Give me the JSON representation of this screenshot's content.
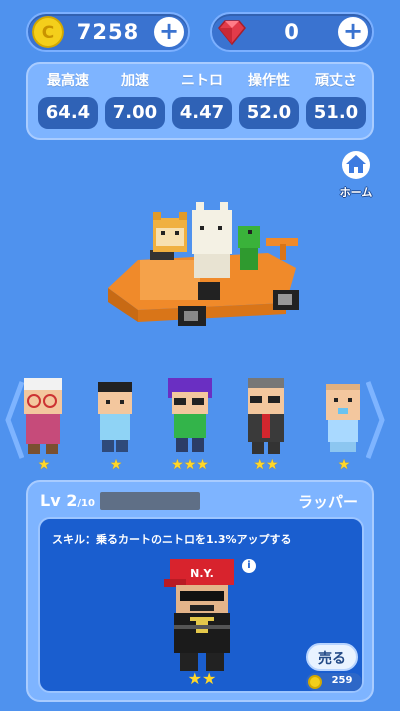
{
  "currency": {
    "coins": "7258",
    "gems": "0",
    "coin_icon": "coin-icon",
    "gem_icon": "gem-icon",
    "plus_label": "+"
  },
  "stats": [
    {
      "label": "最高速",
      "value": "64.4"
    },
    {
      "label": "加速",
      "value": "7.00"
    },
    {
      "label": "ニトロ",
      "value": "4.47"
    },
    {
      "label": "操作性",
      "value": "52.0"
    },
    {
      "label": "頑丈さ",
      "value": "51.0"
    }
  ],
  "home": {
    "label": "ホーム",
    "icon": "home-icon"
  },
  "characters": [
    {
      "name": "granny",
      "stars": "★"
    },
    {
      "name": "boy",
      "stars": "★"
    },
    {
      "name": "purple-hair",
      "stars": "★★★"
    },
    {
      "name": "businessman",
      "stars": "★★"
    },
    {
      "name": "baby",
      "stars": "★"
    }
  ],
  "detail": {
    "level_prefix": "Lv 2",
    "level_max": "/10",
    "character_name": "ラッパー",
    "skill_text": "スキル：乗るカートのニトロを1.3%アップする",
    "info_label": "i",
    "stars": "★★",
    "sell_label": "売る",
    "price": "259"
  },
  "colors": {
    "background": "#4f92ee",
    "panel": "#7eb4ff",
    "stat_box": "#2f62b6",
    "star": "#ffd72a",
    "gem": "#e23b4a",
    "coin": "#f4cf1b"
  }
}
